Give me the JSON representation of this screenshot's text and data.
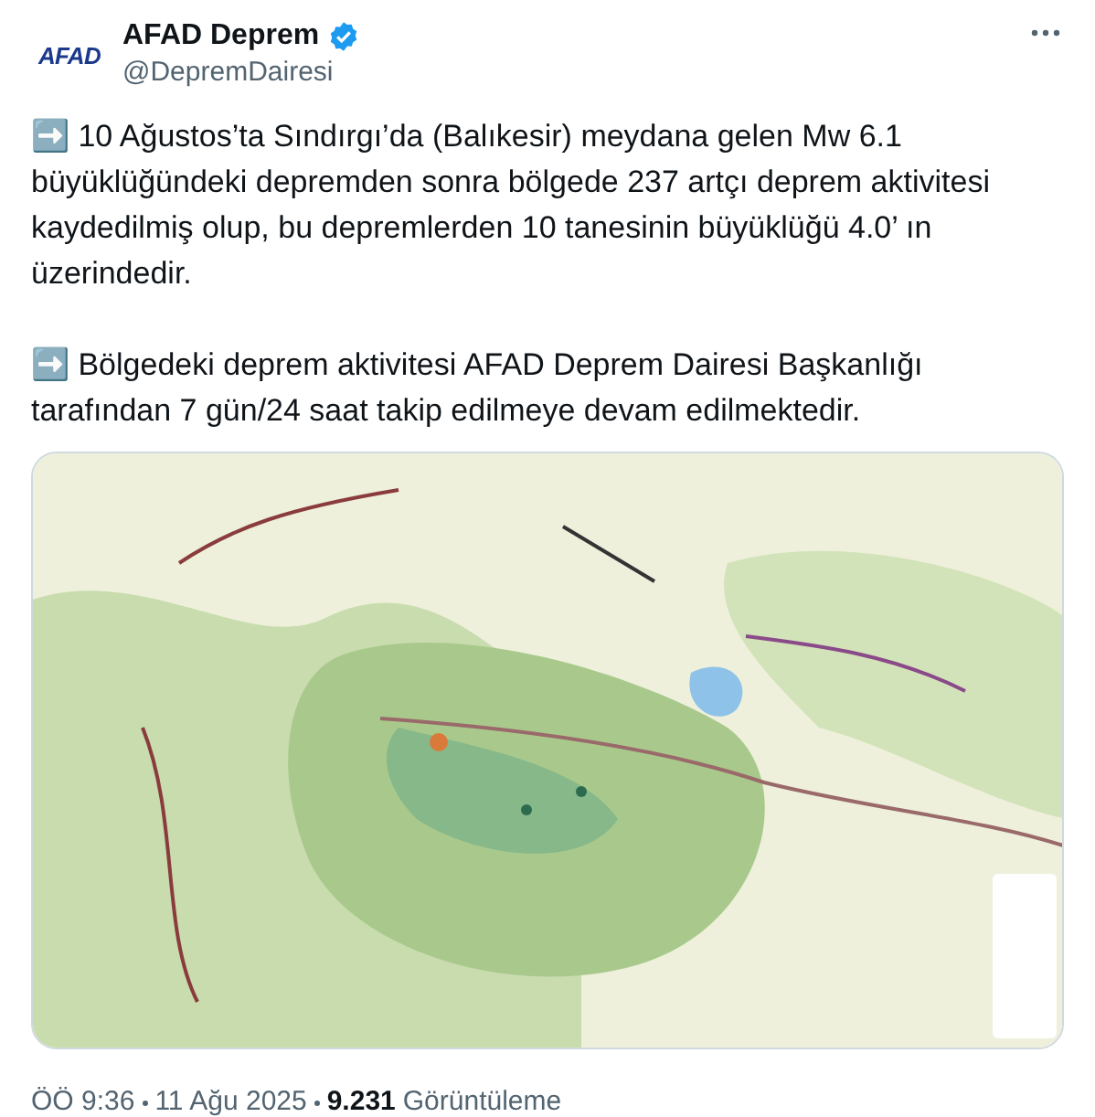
{
  "author": {
    "logo_text": "AFAD",
    "name": "AFAD Deprem",
    "verified": true,
    "handle": "@DepremDairesi"
  },
  "paragraphs": [
    "➡️ 10 Ağustos’ta Sındırgı’da  (Balıkesir) meydana gelen Mw 6.1 büyüklüğündeki depremden sonra bölgede 237 artçı deprem aktivitesi kaydedilmiş olup, bu depremlerden 10 tanesinin büyüklüğü 4.0’ ın üzerindedir.",
    "➡️ Bölgedeki deprem aktivitesi AFAD Deprem Dairesi Başkanlığı tarafından 7 gün/24 saat takip edilmeye devam edilmektedir."
  ],
  "footer": {
    "time": "ÖÖ 9:36",
    "date": "11 Ağu 2025",
    "views": "9.231",
    "views_label": "Görüntüleme"
  }
}
